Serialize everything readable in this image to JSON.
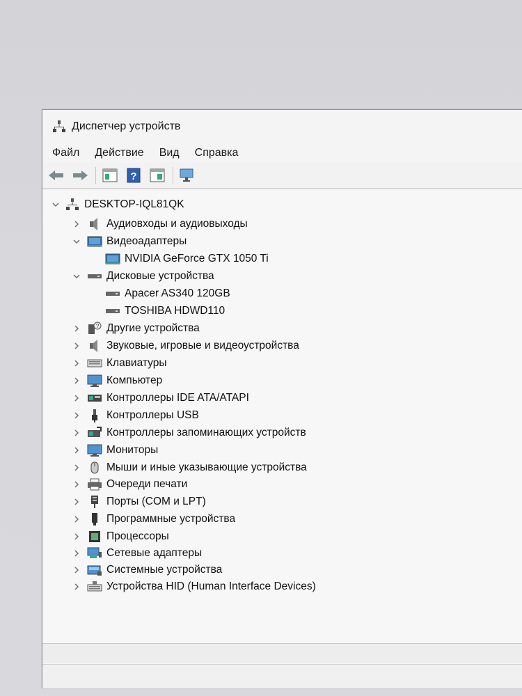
{
  "window": {
    "title": "Диспетчер устройств"
  },
  "menu": {
    "file": "Файл",
    "action": "Действие",
    "view": "Вид",
    "help": "Справка"
  },
  "toolbar": {
    "icons": [
      "back-icon",
      "forward-icon",
      "properties-icon",
      "help-icon",
      "update-driver-icon",
      "scan-hardware-icon"
    ]
  },
  "tree": {
    "root": "DESKTOP-IQL81QK",
    "items": [
      {
        "label": "Аудиовходы и аудиовыходы",
        "expanded": false,
        "icon": "speaker-icon"
      },
      {
        "label": "Видеоадаптеры",
        "expanded": true,
        "icon": "display-adapter-icon",
        "children": [
          {
            "label": "NVIDIA GeForce GTX 1050 Ti",
            "icon": "display-adapter-icon"
          }
        ]
      },
      {
        "label": "Дисковые устройства",
        "expanded": true,
        "icon": "disk-drive-icon",
        "children": [
          {
            "label": "Apacer AS340 120GB",
            "icon": "disk-drive-icon"
          },
          {
            "label": "TOSHIBA HDWD110",
            "icon": "disk-drive-icon"
          }
        ]
      },
      {
        "label": "Другие устройства",
        "expanded": false,
        "icon": "unknown-device-icon"
      },
      {
        "label": "Звуковые, игровые и видеоустройства",
        "expanded": false,
        "icon": "speaker-icon"
      },
      {
        "label": "Клавиатуры",
        "expanded": false,
        "icon": "keyboard-icon"
      },
      {
        "label": "Компьютер",
        "expanded": false,
        "icon": "computer-icon"
      },
      {
        "label": "Контроллеры IDE ATA/ATAPI",
        "expanded": false,
        "icon": "ide-controller-icon"
      },
      {
        "label": "Контроллеры USB",
        "expanded": false,
        "icon": "usb-icon"
      },
      {
        "label": "Контроллеры запоминающих устройств",
        "expanded": false,
        "icon": "storage-controller-icon"
      },
      {
        "label": "Мониторы",
        "expanded": false,
        "icon": "monitor-icon"
      },
      {
        "label": "Мыши и иные указывающие устройства",
        "expanded": false,
        "icon": "mouse-icon"
      },
      {
        "label": "Очереди печати",
        "expanded": false,
        "icon": "printer-icon"
      },
      {
        "label": "Порты (COM и LPT)",
        "expanded": false,
        "icon": "port-icon"
      },
      {
        "label": "Программные устройства",
        "expanded": false,
        "icon": "software-device-icon"
      },
      {
        "label": "Процессоры",
        "expanded": false,
        "icon": "processor-icon"
      },
      {
        "label": "Сетевые адаптеры",
        "expanded": false,
        "icon": "network-adapter-icon"
      },
      {
        "label": "Системные устройства",
        "expanded": false,
        "icon": "system-device-icon"
      },
      {
        "label": "Устройства HID (Human Interface Devices)",
        "expanded": false,
        "icon": "hid-icon"
      }
    ]
  },
  "colors": {
    "window_bg": "#f4f4f4",
    "text": "#111111",
    "chevron": "#6f6f6f",
    "accent_blue": "#2f6fb3"
  }
}
